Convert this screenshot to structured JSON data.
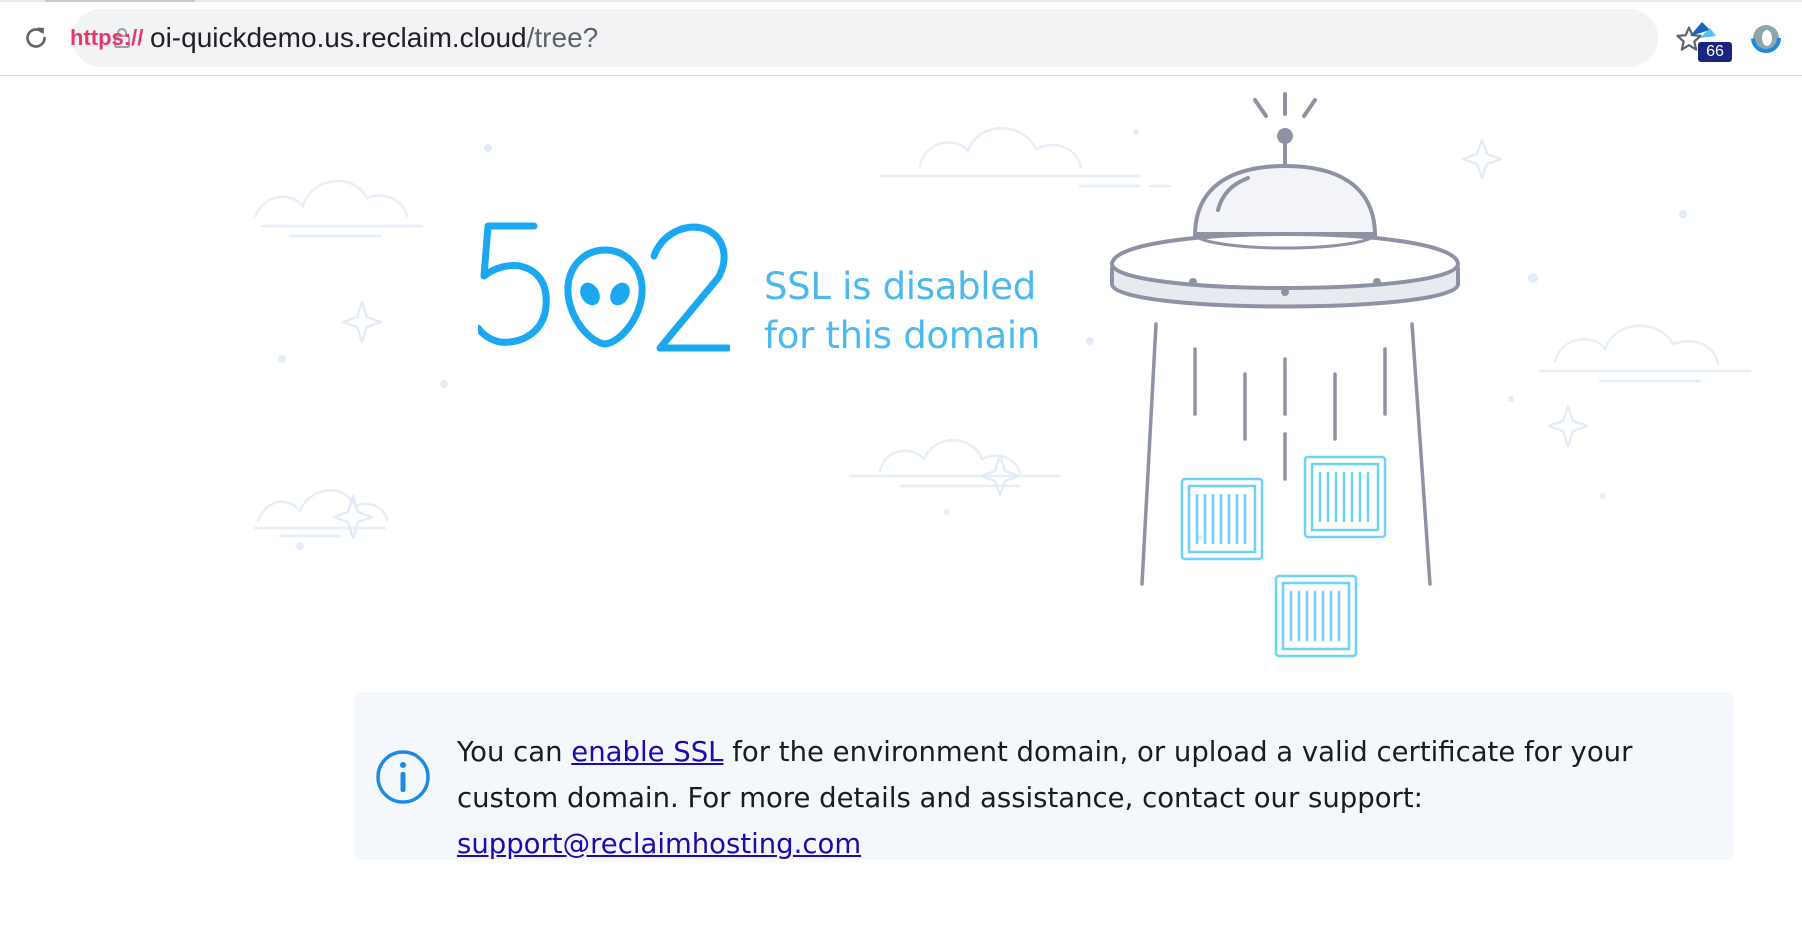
{
  "browser": {
    "url_scheme": "https://",
    "url_host": "oi-quickdemo.us.reclaim.cloud",
    "url_path": "/tree?",
    "extension_badge": "66",
    "icons": {
      "reload": "reload-icon",
      "lock": "lock-icon",
      "bookmark": "star-icon",
      "extension_1": "extension-icon",
      "extension_2": "extension-ring-icon"
    }
  },
  "error": {
    "code": "502",
    "tagline_line1": "SSL is disabled",
    "tagline_line2": "for this domain",
    "accent_color": "#4ab9ee"
  },
  "info_box": {
    "text_1": "You can ",
    "link_enable_ssl": "enable SSL",
    "text_2": " for the environment domain, or upload a valid certificate for your custom domain. For more details and assistance, contact our support: ",
    "link_support_email": "support@reclaimhosting.com",
    "icon": "info-icon"
  }
}
